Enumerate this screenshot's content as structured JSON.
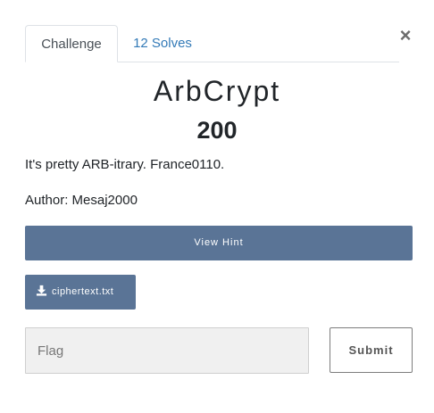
{
  "modal": {
    "close_label": "×"
  },
  "tabs": [
    {
      "label": "Challenge",
      "active": true
    },
    {
      "label": "12 Solves",
      "active": false
    }
  ],
  "challenge": {
    "name": "ArbCrypt",
    "value": "200",
    "description": "It's pretty ARB-itrary. France0110.",
    "author": "Author: Mesaj2000"
  },
  "hint": {
    "button_label": "View Hint"
  },
  "files": [
    {
      "name": "ciphertext.txt",
      "icon": "download-icon"
    }
  ],
  "submission": {
    "placeholder": "Flag",
    "value": "",
    "submit_label": "Submit"
  },
  "colors": {
    "accent": "#5a7496",
    "link": "#337ab7"
  }
}
